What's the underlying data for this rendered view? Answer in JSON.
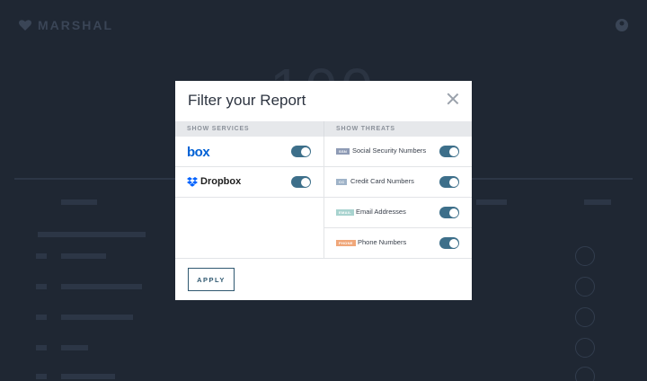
{
  "app": {
    "logo_text": "MARSHAL",
    "logo_icon": "heart-shield-icon",
    "top_right_icon": "user-icon",
    "big_number": "100"
  },
  "modal": {
    "title": "Filter your Report",
    "close_icon": "close-icon",
    "services_header": "SHOW SERVICES",
    "threats_header": "SHOW THREATS",
    "services": [
      {
        "name": "box",
        "enabled": true
      },
      {
        "name": "Dropbox",
        "enabled": true
      }
    ],
    "threats": [
      {
        "badge": "SSN",
        "badge_color": "#8e9bb5",
        "label": "Social Security Numbers",
        "enabled": true
      },
      {
        "badge": "CC",
        "badge_color": "#9fb3c8",
        "label": "Credit Card Numbers",
        "enabled": true
      },
      {
        "badge": "EMAIL",
        "badge_color": "#a8d3cf",
        "label": "Email Addresses",
        "enabled": true
      },
      {
        "badge": "PHONE",
        "badge_color": "#f0a77a",
        "label": "Phone Numbers",
        "enabled": true
      }
    ],
    "apply_label": "APPLY"
  },
  "colors": {
    "background": "#1f2733",
    "toggle_on": "#3d6f8a",
    "accent": "#2f5870",
    "box_blue": "#0061d5"
  }
}
